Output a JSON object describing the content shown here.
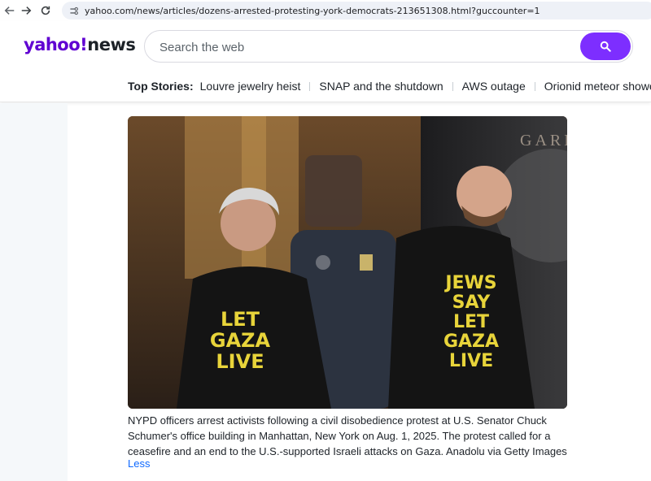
{
  "browser": {
    "url": "yahoo.com/news/articles/dozens-arrested-protesting-york-democrats-213651308.html?guccounter=1",
    "icons": [
      "back-arrow-icon",
      "forward-arrow-icon",
      "reload-icon",
      "site-settings-icon"
    ]
  },
  "header": {
    "logo_main": "yahoo",
    "logo_bang": "!",
    "logo_news": "news",
    "search_placeholder": "Search the web",
    "search_icon": "search-icon",
    "brand_color": "#6001d2",
    "button_color": "#7d2eff"
  },
  "top_stories": {
    "label": "Top Stories:",
    "links": [
      "Louvre jewelry heist",
      "SNAP and the shutdown",
      "AWS outage",
      "Orionid meteor shower"
    ]
  },
  "article": {
    "photo_alt": "Photo of activists being arrested",
    "shirt_text_left": [
      "LET",
      "GAZA",
      "LIVE"
    ],
    "shirt_text_right": [
      "JEWS",
      "SAY",
      "LET",
      "GAZA",
      "LIVE"
    ],
    "sign_text": "GARD",
    "caption": "NYPD officers arrest activists following a civil disobedience protest at U.S. Senator Chuck Schumer's office building in Manhattan, New York on Aug. 1, 2025. The protest called for a ceasefire and an end to the U.S.-supported Israeli attacks on Gaza. Anadolu via Getty Images",
    "less_label": "Less"
  }
}
